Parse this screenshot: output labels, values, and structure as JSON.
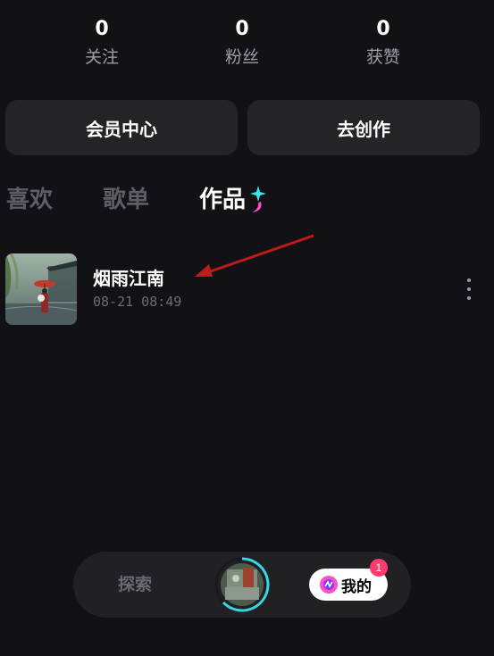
{
  "stats": [
    {
      "value": "0",
      "label": "关注"
    },
    {
      "value": "0",
      "label": "粉丝"
    },
    {
      "value": "0",
      "label": "获赞"
    }
  ],
  "buttons": {
    "member_center": "会员中心",
    "create": "去创作"
  },
  "tabs": [
    {
      "label": "喜欢",
      "active": false
    },
    {
      "label": "歌单",
      "active": false
    },
    {
      "label": "作品",
      "active": true
    }
  ],
  "works": [
    {
      "title": "烟雨江南",
      "time": "08-21 08:49"
    }
  ],
  "nav": {
    "explore_label": "探索",
    "mine_label": "我的",
    "badge_count": "1"
  },
  "colors": {
    "background": "#121216",
    "card": "#232328",
    "accent_badge": "#ff3a6e",
    "sparkle_cyan": "#3ee8e0",
    "sparkle_pink": "#ff4fc2",
    "annotation_arrow": "#c01a1a"
  }
}
